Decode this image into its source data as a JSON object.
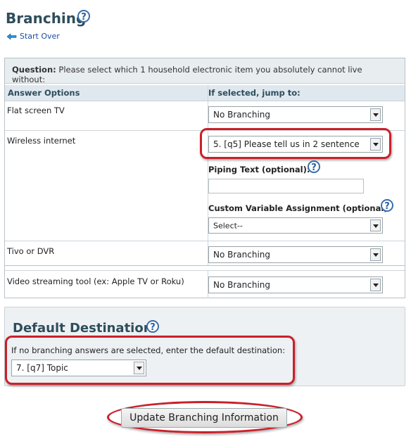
{
  "page": {
    "title": "Branching",
    "start_over": "Start Over"
  },
  "question": {
    "label": "Question:",
    "text": "Please select which 1 household electronic item you absolutely cannot live without:"
  },
  "table": {
    "col_answer": "Answer Options",
    "col_jump": "If selected, jump to:",
    "rows": [
      {
        "answer": "Flat screen TV",
        "jump": "No Branching"
      },
      {
        "answer": "Wireless internet",
        "jump": "5. [q5] Please tell us in 2 sentence"
      },
      {
        "answer": "Tivo or DVR",
        "jump": "No Branching"
      },
      {
        "answer": "Video streaming tool (ex: Apple TV or Roku)",
        "jump": "No Branching"
      }
    ],
    "piping_label": "Piping Text (optional):",
    "piping_value": "",
    "custom_var_label": "Custom Variable Assignment (optional):",
    "custom_var_value": "Select--"
  },
  "default_destination": {
    "title": "Default Destination",
    "instruction": "If no branching answers are selected, enter the default destination:",
    "value": "7. [q7] Topic"
  },
  "update_button": "Update Branching Information",
  "colors": {
    "heading": "#2e4d5c",
    "highlight": "#c9202a",
    "link": "#1a4fa0"
  }
}
